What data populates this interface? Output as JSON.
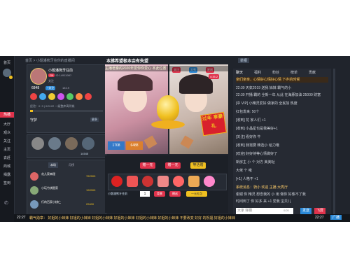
{
  "nav": {
    "items": [
      "首页",
      "大厅",
      "观众",
      "关注",
      "主页",
      "去赶",
      "商城",
      "揭露",
      "签到"
    ],
    "hot_label": "热播"
  },
  "breadcrumb": {
    "home": "首页",
    "room": "小题潘熊牙往你的直播间"
  },
  "stream_title": "本拂希望极本会有失望",
  "header_right": "举报",
  "anchor": {
    "name": "小题潘熊牙往前",
    "level_badge": "G6",
    "room_id": "ID 1491198?",
    "fans_label": "关注",
    "fans_count": "6848",
    "follow_label": "+关注",
    "rank_label": "18:19",
    "exp_text": "经验：0~3 | 0/9122 一级整库离明城"
  },
  "fans_section": {
    "title": "守护",
    "more": "更多"
  },
  "guard_count": "14545",
  "rank": {
    "tabs": [
      "本场",
      "月榜"
    ],
    "rows": [
      {
        "rank": "1",
        "name": "花儿家商理",
        "score": "762900"
      },
      {
        "rank": "2",
        "name": "小玩竹棋是家",
        "score": "192000"
      },
      {
        "rank": "3",
        "name": "行的百家小棋仁",
        "score": "29400"
      }
    ]
  },
  "video": {
    "ticker": "主播老秦的2020年爱你你爱心 本此位置",
    "follow_btn": "关注",
    "level_tag": "大秀",
    "event_tag": "星闻",
    "count_display": "4:35.2",
    "badge_big": "过年 享豪礼",
    "left_num": "1708",
    "left_num2": "6488",
    "gift_bar": "小题潘熊牙往前"
  },
  "controls": {
    "btn1": "赠一无",
    "btn2": "赠一无",
    "btn3": "等活赠",
    "qty": "1",
    "buy_btn": "背景",
    "send_btn": "赠送",
    "gift_btn": "一元礼包",
    "sender": "小题潘熊牙往前"
  },
  "chat": {
    "tabs": [
      "聊天",
      "福利",
      "粉丝",
      "榜单",
      "贡献"
    ],
    "announcement": "亲们亲亲，心情好心情好心情 下乡的时候",
    "lines": [
      "22:30 天氣2019 送我 姊妹 霸气的小 ",
      "22:30 开播  霸的 全新一年 从此 在海豚加油 25000 财富",
      "[中 VIP] 小精灵爱好 做家的 全民加 热度",
      "红包发来: 50个",
      "[收到] 花 家人们 +1",
      "[收到] 小晶星也是我美好+1",
      "[关注] 看好你 牛",
      "[收到] 我需要 精选小 给力哦",
      "[欢迎] 好好待等心情做好了",
      "新房主 小 个 对方 美美哒",
      "大佬 个 哦",
      "[+1] 人格不 +1",
      "系统消息：骑小 欢迎 主播 大秀厅",
      "谢谢 你 精灵 想念我的 小 用 做你 好像不了我",
      "时间到了 你 好多 来 +1 爱我 宝贝儿"
    ],
    "input_placeholder": "大家  弹幕",
    "input_counter": "0/20",
    "send_label": "发送",
    "fly_label": "飞屏"
  },
  "bottom": {
    "time": "22:27",
    "text": "霸气勋章：  好姐的小妹妹  好姐的小妹妹  好姐的小妹妹  好姐的小妹妹  好姐的小妹妹  好姐的小妹妹  不要改变 好好 的祝福  好姐的小妹妹",
    "right": "22:27",
    "right_btn": "广播"
  },
  "colors": {
    "accent": "#e0334c",
    "gold": "#f0c020",
    "bg": "#20242c"
  }
}
